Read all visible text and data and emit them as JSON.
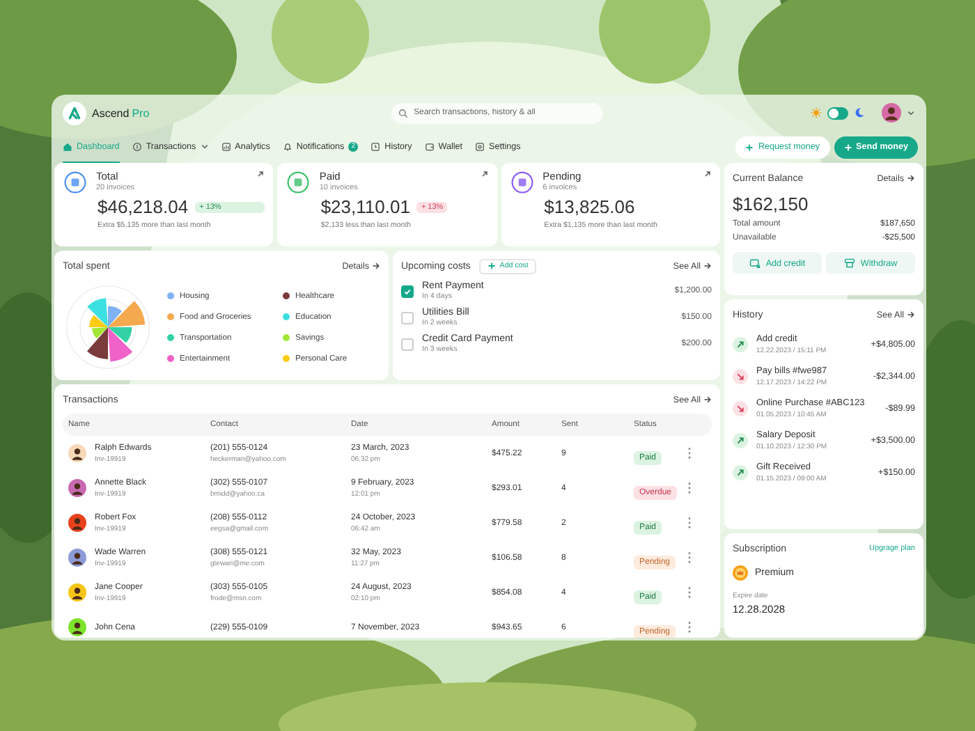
{
  "brand": {
    "name": "Ascend",
    "edition": "Pro"
  },
  "search": {
    "placeholder": "Search transactions, history & all"
  },
  "theme_toggle": {
    "dark": false
  },
  "nav": [
    {
      "label": "Dashboard",
      "selected": true,
      "dropdown": false
    },
    {
      "label": "Transactions",
      "selected": false,
      "dropdown": true
    },
    {
      "label": "Analytics",
      "selected": false,
      "dropdown": false
    },
    {
      "label": "Notifications",
      "selected": false,
      "dropdown": false,
      "count": "2"
    },
    {
      "label": "History",
      "selected": false,
      "dropdown": false
    },
    {
      "label": "Wallet",
      "selected": false,
      "dropdown": false
    },
    {
      "label": "Settings",
      "selected": false,
      "dropdown": false
    }
  ],
  "actions": [
    {
      "label": "Request money",
      "kind": "secondary"
    },
    {
      "label": "Send money",
      "kind": "primary"
    }
  ],
  "stats": [
    {
      "title": "Total",
      "subtitle": "20 invoices",
      "amount": "$46,218.04",
      "change": "+ 13%",
      "kind": "up",
      "note": "Extra $5,135 more than last month",
      "color": "#4a90f0"
    },
    {
      "title": "Paid",
      "subtitle": "10 invoices",
      "amount": "$23,110.01",
      "change": "+ 13%",
      "kind": "down",
      "note": "$2,133 less than last month",
      "color": "#3cc06a"
    },
    {
      "title": "Pending",
      "subtitle": "6 invoices",
      "amount": "$13,825.06",
      "note": "Extra $1,135 more than last month",
      "color": "#8a5cf0"
    }
  ],
  "total_spent": {
    "title": "Total spent",
    "link": "Details",
    "legend": [
      {
        "label": "Housing",
        "color": "#7fb2f5"
      },
      {
        "label": "Healthcare",
        "color": "#7a3b3b"
      },
      {
        "label": "Food and Groceries",
        "color": "#f5a94e"
      },
      {
        "label": "Education",
        "color": "#3de0e0"
      },
      {
        "label": "Transportation",
        "color": "#33d1a5"
      },
      {
        "label": "Savings",
        "color": "#a3e635"
      },
      {
        "label": "Entertainment",
        "color": "#f062c8"
      },
      {
        "label": "Personal Care",
        "color": "#facc15"
      }
    ]
  },
  "upcoming_costs": {
    "title": "Upcoming costs",
    "add": "Add cost",
    "link": "See All",
    "items": [
      {
        "title": "Rent Payment",
        "due": "In 4 days",
        "amount": "$1,200.00",
        "checked": true
      },
      {
        "title": "Utilities Bill",
        "due": "In 2 weeks",
        "amount": "$150.00",
        "checked": false
      },
      {
        "title": "Credit Card Payment",
        "due": "In 3 weeks",
        "amount": "$200.00",
        "checked": false
      }
    ]
  },
  "transactions": {
    "title": "Transactions",
    "link": "See All",
    "columns": [
      "Name",
      "Contact",
      "Date",
      "Amount",
      "Sent",
      "Status"
    ],
    "rows": [
      {
        "name": "Ralph Edwards",
        "invoice": "Inv-19919",
        "phone": "(201) 555-0124",
        "email": "heckerman@yahoo.com",
        "date": "23 March, 2023",
        "time": "06:32 pm",
        "amount": "$475.22",
        "sent": "9",
        "status": "Paid",
        "kind": "paid",
        "color": "#f6d9b8"
      },
      {
        "name": "Annette Black",
        "invoice": "Inv-19919",
        "phone": "(302) 555-0107",
        "email": "bmidd@yahoo.ca",
        "date": "9 February, 2023",
        "time": "12:01 pm",
        "amount": "$293.01",
        "sent": "4",
        "status": "Overdue",
        "kind": "overdue",
        "color": "#c76bb0"
      },
      {
        "name": "Robert Fox",
        "invoice": "Inv-19919",
        "phone": "(208) 555-0112",
        "email": "eegsa@gmail.com",
        "date": "24 October, 2023",
        "time": "06:42 am",
        "amount": "$779.58",
        "sent": "2",
        "status": "Paid",
        "kind": "paid",
        "color": "#e8421c"
      },
      {
        "name": "Wade Warren",
        "invoice": "Inv-19919",
        "phone": "(308) 555-0121",
        "email": "gtewari@me.com",
        "date": "32 May, 2023",
        "time": "11:27 pm",
        "amount": "$106.58",
        "sent": "8",
        "status": "Pending",
        "kind": "pending",
        "color": "#8b9bd6"
      },
      {
        "name": "Jane Cooper",
        "invoice": "Inv-19919",
        "phone": "(303) 555-0105",
        "email": "frode@msn.com",
        "date": "24 August, 2023",
        "time": "02:10 pm",
        "amount": "$854.08",
        "sent": "4",
        "status": "Paid",
        "kind": "paid",
        "color": "#f5c518"
      },
      {
        "name": "John Cena",
        "phone": "(229) 555-0109",
        "date": "7 November, 2023",
        "amount": "$943.65",
        "sent": "6",
        "status": "Pending",
        "kind": "pending",
        "color": "#7de32c"
      }
    ]
  },
  "balance": {
    "title": "Current Balance",
    "link": "Details",
    "amount": "$162,150",
    "lines": [
      {
        "label": "Total  amount",
        "value": "$187,650"
      },
      {
        "label": "Unavailable",
        "value": "-$25,500"
      }
    ],
    "buttons": [
      {
        "label": "Add credit"
      },
      {
        "label": "Withdraw"
      }
    ]
  },
  "history": {
    "title": "History",
    "link": "See All",
    "items": [
      {
        "title": "Add credit",
        "date": "12.22.2023 / 15:11 PM",
        "amount": "+$4,805.00",
        "kind": "in"
      },
      {
        "title": "Pay bills #fwe987",
        "date": "12.17.2023 / 14:22 PM",
        "amount": "-$2,344.00",
        "kind": "out"
      },
      {
        "title": "Online Purchase #ABC123",
        "date": "01.05.2023 / 10:45 AM",
        "amount": "-$89.99",
        "kind": "out"
      },
      {
        "title": "Salary Deposit",
        "date": "01.10.2023 / 12:30 PM",
        "amount": "+$3,500.00",
        "kind": "in"
      },
      {
        "title": "Gift Received",
        "date": "01.15.2023 / 09:00 AM",
        "amount": "+$150.00",
        "kind": "in"
      }
    ]
  },
  "subscription": {
    "title": "Subscription",
    "link": "Upgrage plan",
    "plan": "Premium",
    "expire_label": "Expire date",
    "expire_date": "12.28.2028"
  }
}
